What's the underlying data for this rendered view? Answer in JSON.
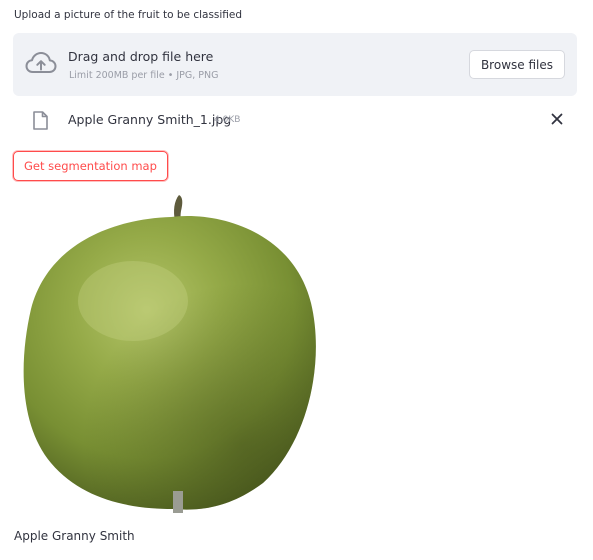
{
  "uploader": {
    "label": "Upload a picture of the fruit to be classified",
    "drop_title": "Drag and drop file here",
    "drop_hint": "Limit 200MB per file • JPG, PNG",
    "browse_label": "Browse files",
    "icon": "cloud-upload-icon"
  },
  "uploaded_file": {
    "name": "Apple Granny Smith_1.jpg",
    "size": "4.0KB",
    "icon": "file-icon",
    "remove_icon": "close-icon"
  },
  "segmentation_button": {
    "label": "Get segmentation map"
  },
  "result": {
    "caption": "Apple Granny Smith"
  },
  "colors": {
    "accent": "#ff4b4b",
    "dropzone_bg": "#f0f2f6",
    "text": "#31333f",
    "muted": "#9a9da7",
    "apple_green": "#8ba03f"
  }
}
